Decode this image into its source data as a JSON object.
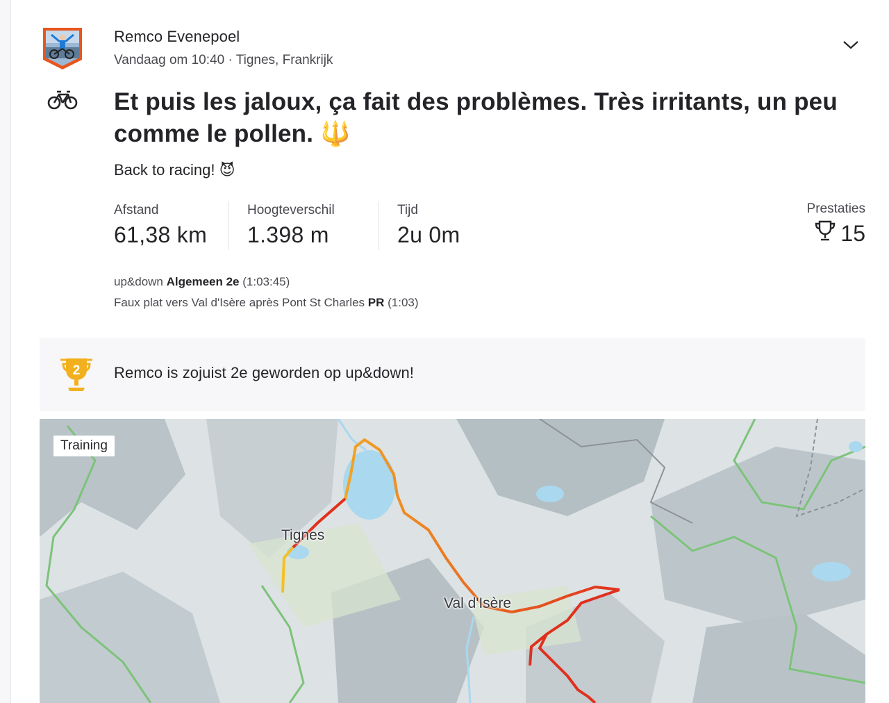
{
  "athlete": {
    "name": "Remco Evenepoel",
    "meta": "Vandaag om 10:40 · Tignes, Frankrijk",
    "avatar_icon": "athlete-avatar-shield"
  },
  "activity": {
    "sport_icon": "bike-icon",
    "title": "Et puis les jaloux, ça fait des problèmes. Très irritants, un peu comme le pollen. 🔱",
    "description": "Back to racing! 😈"
  },
  "stats": [
    {
      "label": "Afstand",
      "value": "61,38 km"
    },
    {
      "label": "Hoogteverschil",
      "value": "1.398 m"
    },
    {
      "label": "Tijd",
      "value": "2u 0m"
    }
  ],
  "achievements": {
    "label": "Prestaties",
    "count": "15"
  },
  "segments": [
    {
      "name": "up&down",
      "rank": "Algemeen 2e",
      "time": "(1:03:45)"
    },
    {
      "name": "Faux plat vers Val d'Isère après Pont St Charles",
      "rank": "PR",
      "time": "(1:03)"
    }
  ],
  "banner": {
    "trophy_rank": "2",
    "text": "Remco is zojuist 2e geworden op up&down!"
  },
  "map": {
    "tag": "Training",
    "places": [
      "Tignes",
      "Val d'Isère"
    ]
  },
  "colors": {
    "trophy_gold": "#f2b01e",
    "route_red": "#e0301e",
    "route_yellow": "#f5c026",
    "water": "#a9d8ef",
    "border_green": "#7cc37a"
  }
}
